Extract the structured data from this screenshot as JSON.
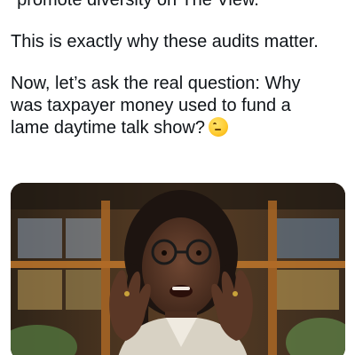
{
  "post": {
    "quote_line": "\"promote diversity on The View.\"",
    "paragraph_1": "This is exactly why these audits matter.",
    "paragraph_2_lines": [
      "Now, let’s ask the real question: Why",
      "was taxpayer money used to fund a",
      "lame daytime talk show?"
    ],
    "emoji": "thinking-face-emoji"
  },
  "media": {
    "type": "video-still",
    "subject": "talk-show-host-speaking"
  },
  "colors": {
    "text": "#0f1419",
    "background": "#ffffff"
  }
}
